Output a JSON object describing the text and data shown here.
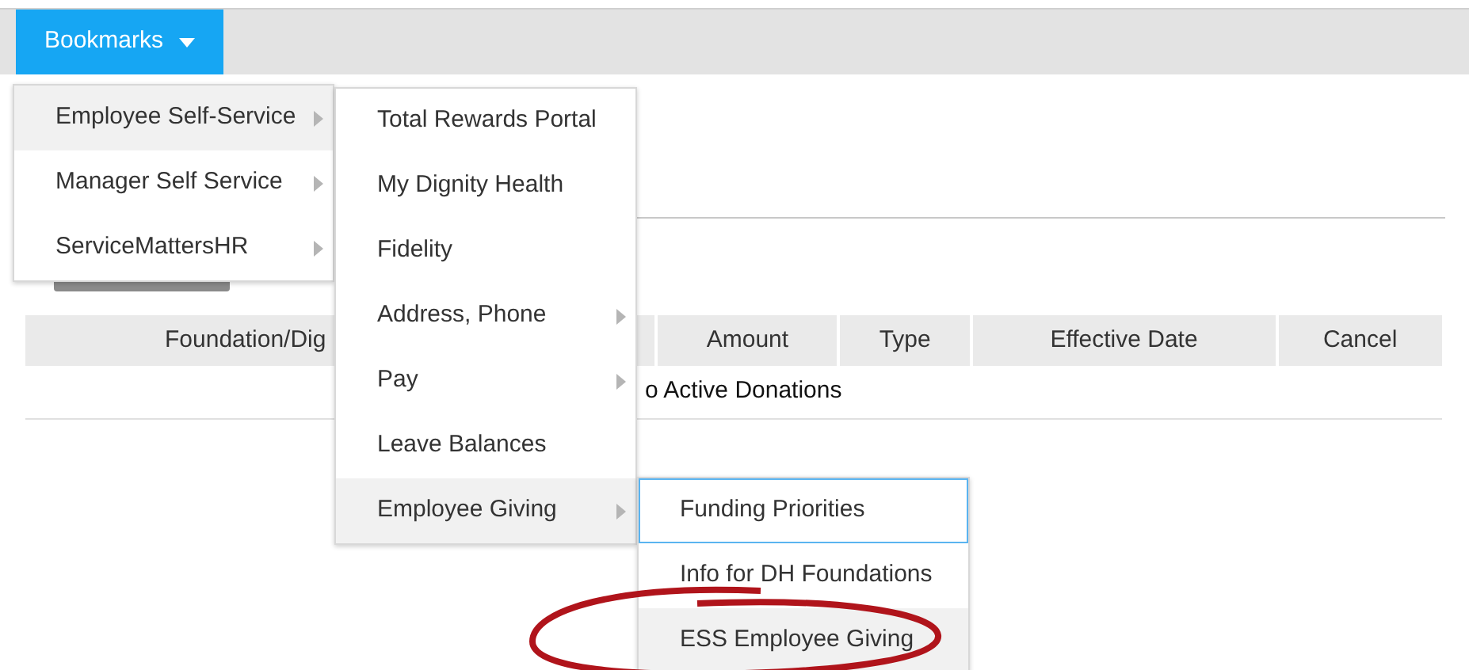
{
  "toolbar": {
    "bookmarks_button": "Bookmarks"
  },
  "page": {
    "table": {
      "columns": [
        "Foundation/Dig",
        "Amount",
        "Type",
        "Effective Date",
        "Cancel"
      ],
      "empty_message": "o Active Donations"
    }
  },
  "menus": [
    {
      "items": [
        {
          "label": "Employee Self-Service",
          "submenu": true,
          "selected": true
        },
        {
          "label": "Manager Self Service",
          "submenu": true,
          "selected": false
        },
        {
          "label": "ServiceMattersHR",
          "submenu": true,
          "selected": false
        }
      ]
    },
    {
      "items": [
        {
          "label": "Total Rewards Portal",
          "submenu": false,
          "selected": false
        },
        {
          "label": "My Dignity Health",
          "submenu": false,
          "selected": false
        },
        {
          "label": "Fidelity",
          "submenu": false,
          "selected": false
        },
        {
          "label": "Address, Phone",
          "submenu": true,
          "selected": false
        },
        {
          "label": "Pay",
          "submenu": true,
          "selected": false
        },
        {
          "label": "Leave Balances",
          "submenu": false,
          "selected": false
        },
        {
          "label": "Employee Giving",
          "submenu": true,
          "selected": true
        }
      ]
    },
    {
      "items": [
        {
          "label": "Funding Priorities",
          "submenu": false,
          "selected": false,
          "focused": true
        },
        {
          "label": "Info for DH Foundations",
          "submenu": false,
          "selected": false,
          "focused": false
        },
        {
          "label": "ESS Employee Giving",
          "submenu": false,
          "selected": true,
          "focused": false
        }
      ]
    }
  ]
}
